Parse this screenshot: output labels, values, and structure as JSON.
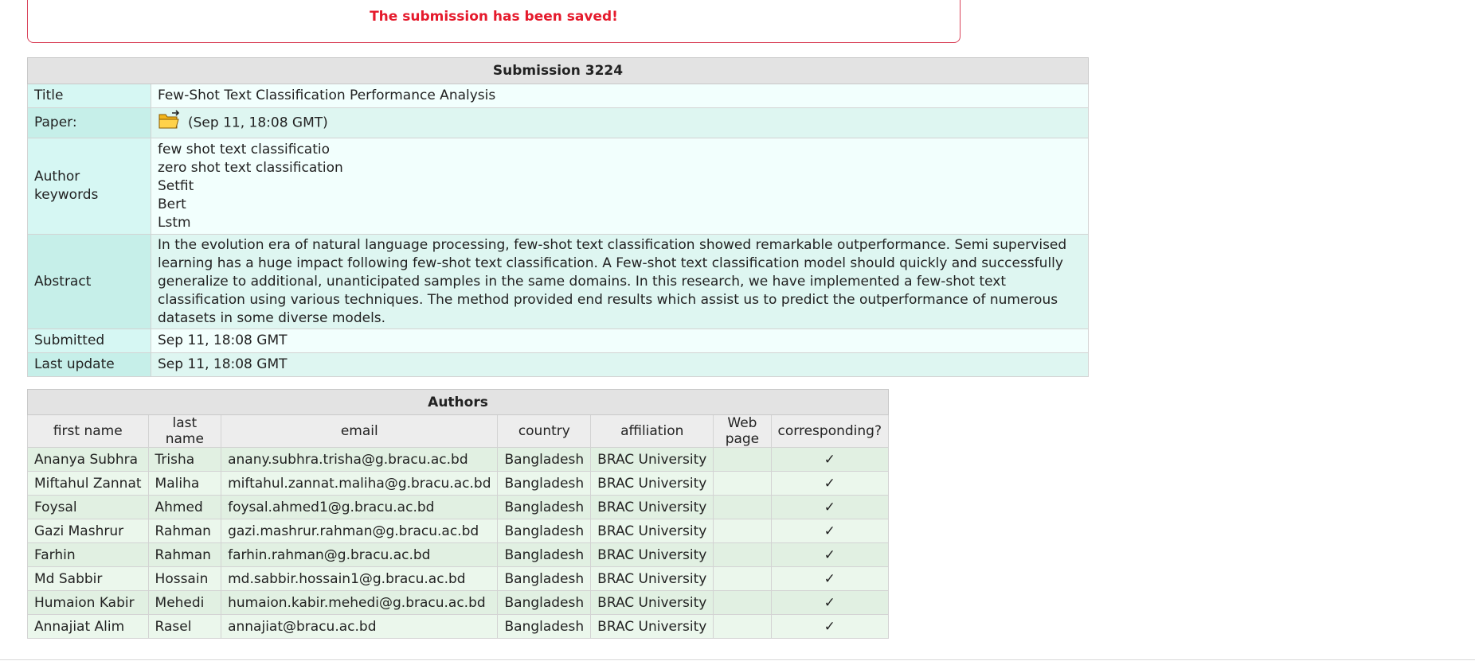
{
  "notice": "The submission has been saved!",
  "submission": {
    "caption": "Submission 3224",
    "title_label": "Title",
    "title": "Few-Shot Text Classification Performance Analysis",
    "paper_label": "Paper:",
    "paper_icon": "folder-icon",
    "paper_date": "(Sep 11, 18:08 GMT)",
    "keywords_label": "Author keywords",
    "keywords": [
      "few shot text classificatio",
      "zero shot text classification",
      "Setfit",
      "Bert",
      "Lstm"
    ],
    "abstract_label": "Abstract",
    "abstract": "In the evolution era of natural language processing, few-shot text classification showed remarkable outperformance. Semi supervised learning has a huge impact following few-shot text classification. A Few-shot text classification model should quickly and successfully generalize to additional, unanticipated samples in the same domains. In this research, we have implemented a few-shot text classification using various techniques. The method provided end results which assist us to predict the outperformance of numerous datasets in some diverse models.",
    "submitted_label": "Submitted",
    "submitted": "Sep 11, 18:08 GMT",
    "last_update_label": "Last update",
    "last_update": "Sep 11, 18:08 GMT"
  },
  "authors": {
    "caption": "Authors",
    "columns": [
      "first name",
      "last name",
      "email",
      "country",
      "affiliation",
      "Web page",
      "corresponding?"
    ],
    "rows": [
      [
        "Ananya Subhra",
        "Trisha",
        "anany.subhra.trisha@g.bracu.ac.bd",
        "Bangladesh",
        "BRAC University",
        "",
        "✓"
      ],
      [
        "Miftahul Zannat",
        "Maliha",
        "miftahul.zannat.maliha@g.bracu.ac.bd",
        "Bangladesh",
        "BRAC University",
        "",
        "✓"
      ],
      [
        "Foysal",
        "Ahmed",
        "foysal.ahmed1@g.bracu.ac.bd",
        "Bangladesh",
        "BRAC University",
        "",
        "✓"
      ],
      [
        "Gazi Mashrur",
        "Rahman",
        "gazi.mashrur.rahman@g.bracu.ac.bd",
        "Bangladesh",
        "BRAC University",
        "",
        "✓"
      ],
      [
        "Farhin",
        "Rahman",
        "farhin.rahman@g.bracu.ac.bd",
        "Bangladesh",
        "BRAC University",
        "",
        "✓"
      ],
      [
        "Md Sabbir",
        "Hossain",
        "md.sabbir.hossain1@g.bracu.ac.bd",
        "Bangladesh",
        "BRAC University",
        "",
        "✓"
      ],
      [
        "Humaion Kabir",
        "Mehedi",
        "humaion.kabir.mehedi@g.bracu.ac.bd",
        "Bangladesh",
        "BRAC University",
        "",
        "✓"
      ],
      [
        "Annajiat Alim",
        "Rasel",
        "annajiat@bracu.ac.bd",
        "Bangladesh",
        "BRAC University",
        "",
        "✓"
      ]
    ]
  }
}
